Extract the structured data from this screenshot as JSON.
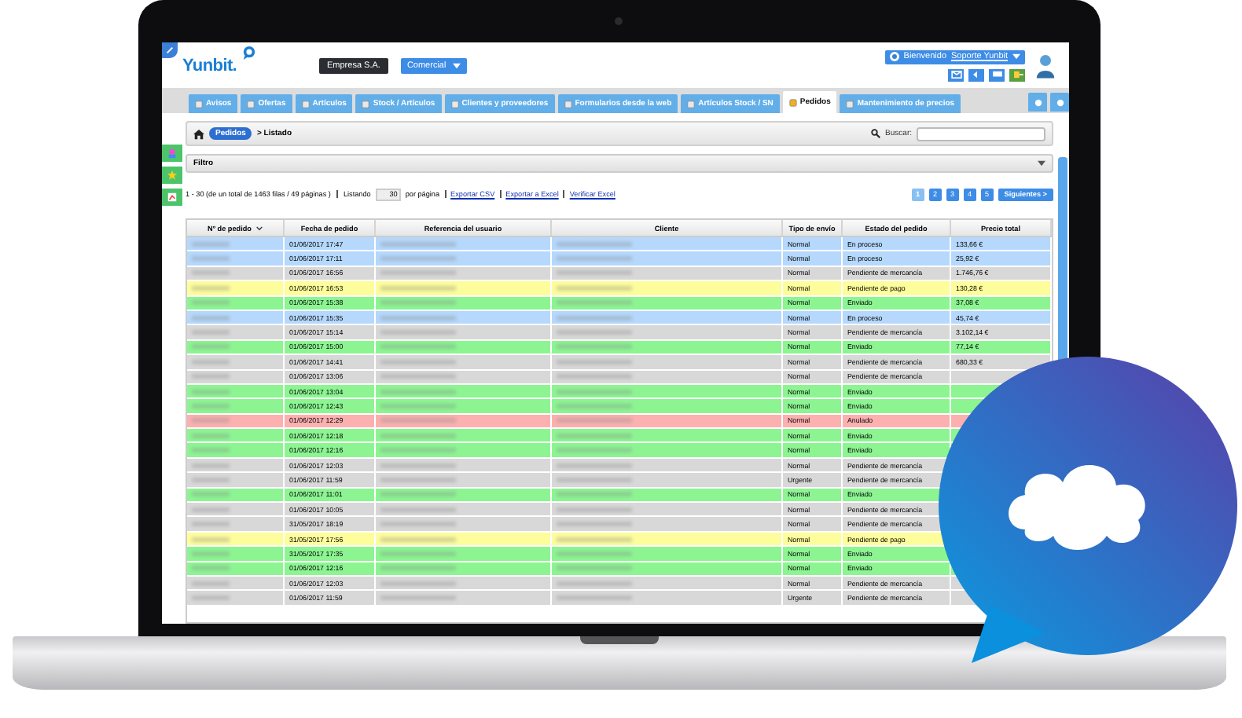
{
  "header": {
    "logo": "Yunbit.",
    "company": "Empresa S.A.",
    "module": "Comercial",
    "welcome": "Bienvenido",
    "user": "Soporte Yunbit"
  },
  "tabs": [
    {
      "label": "Avisos",
      "selected": false
    },
    {
      "label": "Ofertas",
      "selected": false
    },
    {
      "label": "Artículos",
      "selected": false
    },
    {
      "label": "Stock / Artículos",
      "selected": false
    },
    {
      "label": "Clientes y proveedores",
      "selected": false
    },
    {
      "label": "Formularios desde la web",
      "selected": false
    },
    {
      "label": "Artículos Stock / SN",
      "selected": false
    },
    {
      "label": "Pedidos",
      "selected": true
    },
    {
      "label": "Mantenimiento de precios",
      "selected": false
    }
  ],
  "breadcrumb": {
    "section": "Pedidos",
    "page": "> Listado"
  },
  "search": {
    "label": "Buscar:"
  },
  "filter": {
    "label": "Filtro"
  },
  "summary": "1 - 30 (de un total de 1463 filas / 49 páginas )",
  "listing": {
    "label": "Listando",
    "value": "30",
    "suffix": "por página"
  },
  "links": [
    "Exportar CSV",
    "Exportar a Excel",
    "Verificar Excel"
  ],
  "pages": [
    {
      "label": "1",
      "selected": true
    },
    {
      "label": "2",
      "selected": false
    },
    {
      "label": "3",
      "selected": false
    },
    {
      "label": "4",
      "selected": false
    },
    {
      "label": "5",
      "selected": false
    }
  ],
  "next": "Siguientes >",
  "table": {
    "columns": [
      "Nº de pedido",
      "Fecha de pedido",
      "Referencia del usuario",
      "Cliente",
      "Tipo de envío",
      "Estado del pedido",
      "Precio total"
    ],
    "rows": [
      {
        "date": "01/06/2017 17:47",
        "shipping": "Normal",
        "status": "En proceso",
        "price": "133,66 €",
        "color": "#b5d8fc"
      },
      {
        "date": "01/06/2017 17:11",
        "shipping": "Normal",
        "status": "En proceso",
        "price": "25,92 €",
        "color": "#b5d8fc"
      },
      {
        "date": "01/06/2017 16:56",
        "shipping": "Normal",
        "status": "Pendiente de mercancía",
        "price": "1.746,76 €",
        "color": "#d8d8d8"
      },
      {
        "date": "01/06/2017 16:53",
        "shipping": "Normal",
        "status": "Pendiente de pago",
        "price": "130,28 €",
        "color": "#fdfd9c"
      },
      {
        "date": "01/06/2017 15:38",
        "shipping": "Normal",
        "status": "Enviado",
        "price": "37,08 €",
        "color": "#8cf592"
      },
      {
        "date": "01/06/2017 15:35",
        "shipping": "Normal",
        "status": "En proceso",
        "price": "45,74 €",
        "color": "#b5d8fc"
      },
      {
        "date": "01/06/2017 15:14",
        "shipping": "Normal",
        "status": "Pendiente de mercancía",
        "price": "3.102,14 €",
        "color": "#d8d8d8"
      },
      {
        "date": "01/06/2017 15:00",
        "shipping": "Normal",
        "status": "Enviado",
        "price": "77,14 €",
        "color": "#8cf592"
      },
      {
        "date": "01/06/2017 14:41",
        "shipping": "Normal",
        "status": "Pendiente de mercancía",
        "price": "680,33 €",
        "color": "#d8d8d8"
      },
      {
        "date": "01/06/2017 13:06",
        "shipping": "Normal",
        "status": "Pendiente de mercancía",
        "color": "#d8d8d8"
      },
      {
        "date": "01/06/2017 13:04",
        "shipping": "Normal",
        "status": "Enviado",
        "color": "#8cf592"
      },
      {
        "date": "01/06/2017 12:43",
        "shipping": "Normal",
        "status": "Enviado",
        "color": "#8cf592"
      },
      {
        "date": "01/06/2017 12:29",
        "shipping": "Normal",
        "status": "Anulado",
        "color": "#fcb0b0"
      },
      {
        "date": "01/06/2017 12:18",
        "shipping": "Normal",
        "status": "Enviado",
        "color": "#8cf592"
      },
      {
        "date": "01/06/2017 12:16",
        "shipping": "Normal",
        "status": "Enviado",
        "color": "#8cf592"
      },
      {
        "date": "01/06/2017 12:03",
        "shipping": "Normal",
        "status": "Pendiente de mercancía",
        "color": "#d8d8d8"
      },
      {
        "date": "01/06/2017 11:59",
        "shipping": "Urgente",
        "status": "Pendiente de mercancía",
        "color": "#d8d8d8"
      },
      {
        "date": "01/06/2017 11:01",
        "shipping": "Normal",
        "status": "Enviado",
        "color": "#8cf592"
      },
      {
        "date": "01/06/2017 10:05",
        "shipping": "Normal",
        "status": "Pendiente de mercancía",
        "color": "#d8d8d8"
      },
      {
        "date": "31/05/2017 18:19",
        "shipping": "Normal",
        "status": "Pendiente de mercancía",
        "color": "#d8d8d8"
      },
      {
        "date": "31/05/2017 17:56",
        "shipping": "Normal",
        "status": "Pendiente de pago",
        "color": "#fdfd9c"
      },
      {
        "date": "31/05/2017 17:35",
        "shipping": "Normal",
        "status": "Enviado",
        "color": "#8cf592"
      },
      {
        "date": "01/06/2017 12:16",
        "shipping": "Normal",
        "status": "Enviado",
        "color": "#8cf592"
      },
      {
        "date": "01/06/2017 12:03",
        "shipping": "Normal",
        "status": "Pendiente de mercancía",
        "color": "#d8d8d8"
      },
      {
        "date": "01/06/2017 11:59",
        "shipping": "Urgente",
        "status": "Pendiente de mercancía",
        "color": "#d8d8d8"
      }
    ]
  }
}
